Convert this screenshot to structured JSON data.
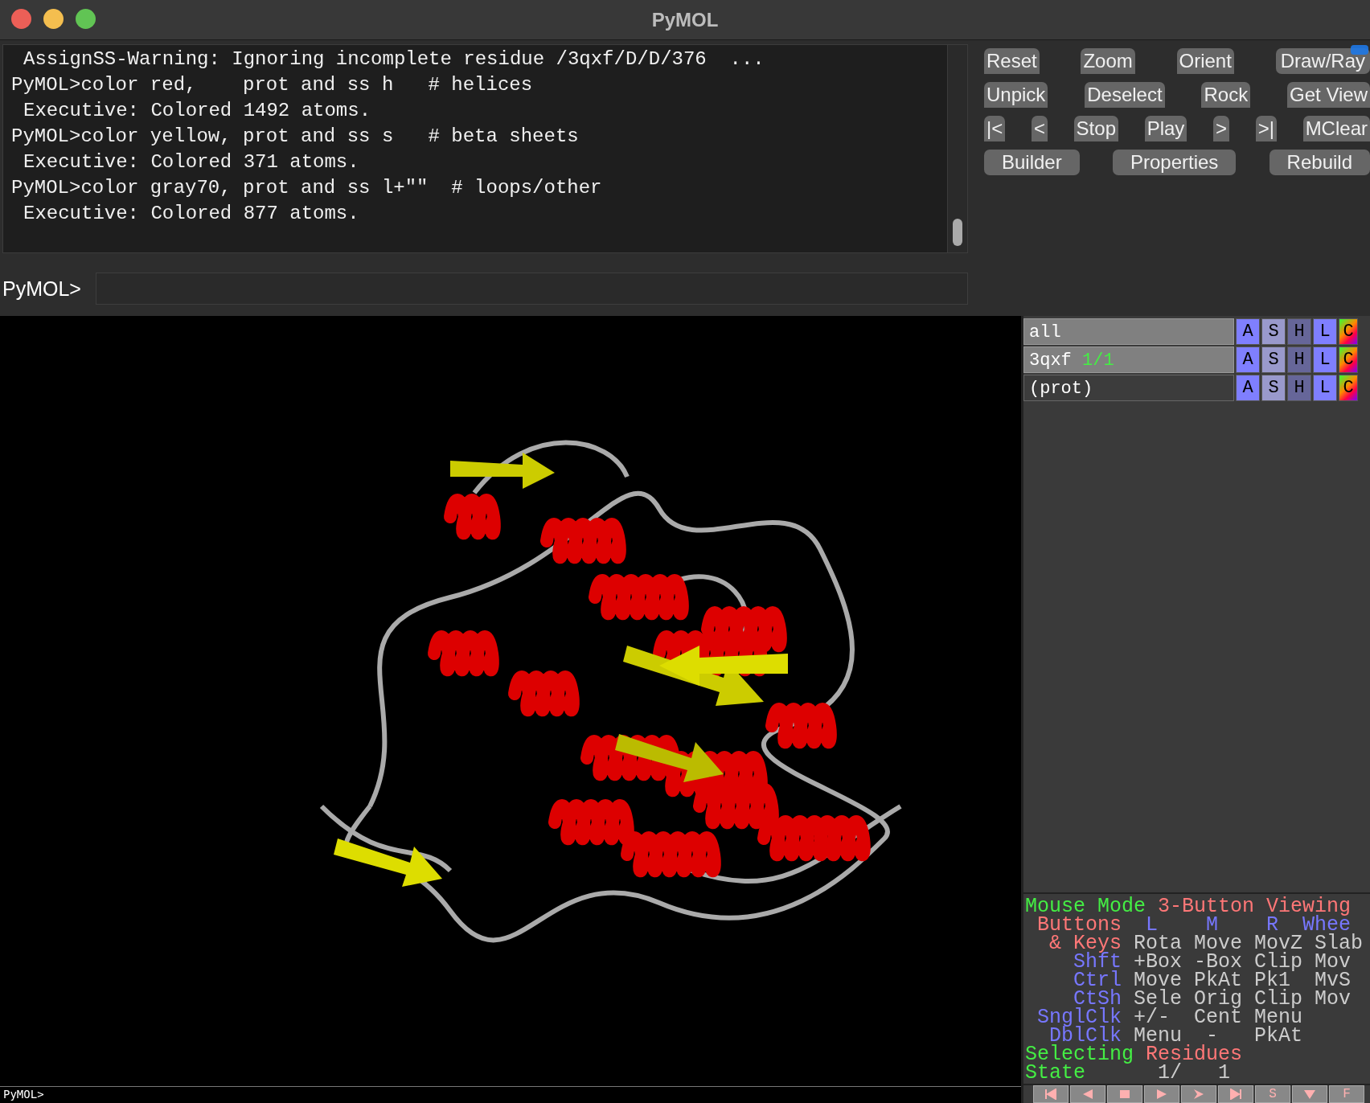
{
  "window": {
    "title": "PyMOL"
  },
  "console": {
    "lines": [
      {
        "kind": "output",
        "text": "AssignSS-Warning: Ignoring incomplete residue /3qxf/D/D/376  ..."
      },
      {
        "kind": "command",
        "text": "PyMOL>color red,    prot and ss h   # helices"
      },
      {
        "kind": "output",
        "text": "Executive: Colored 1492 atoms."
      },
      {
        "kind": "command",
        "text": "PyMOL>color yellow, prot and ss s   # beta sheets"
      },
      {
        "kind": "output",
        "text": "Executive: Colored 371 atoms."
      },
      {
        "kind": "command",
        "text": "PyMOL>color gray70, prot and ss l+\"\"  # loops/other"
      },
      {
        "kind": "output",
        "text": "Executive: Colored 877 atoms."
      }
    ]
  },
  "command_line": {
    "prompt": "PyMOL>"
  },
  "button_rows": [
    [
      {
        "label": "Reset",
        "focused": false
      },
      {
        "label": "Zoom",
        "focused": false
      },
      {
        "label": "Orient",
        "focused": false
      },
      {
        "label": "Draw/Ray",
        "focused": true
      }
    ],
    [
      {
        "label": "Unpick",
        "focused": false
      },
      {
        "label": "Deselect",
        "focused": false
      },
      {
        "label": "Rock",
        "focused": false
      },
      {
        "label": "Get View",
        "focused": false
      }
    ],
    [
      {
        "label": "|<",
        "focused": false
      },
      {
        "label": "<",
        "focused": false
      },
      {
        "label": "Stop",
        "focused": false
      },
      {
        "label": "Play",
        "focused": false
      },
      {
        "label": ">",
        "focused": false
      },
      {
        "label": ">|",
        "focused": false
      },
      {
        "label": "MClear",
        "focused": false
      }
    ],
    [
      {
        "label": "Builder",
        "focused": false
      },
      {
        "label": "Properties",
        "focused": false
      },
      {
        "label": "Rebuild",
        "focused": false
      }
    ]
  ],
  "objects": [
    {
      "name": "all",
      "enabled": true,
      "actions": [
        "A",
        "S",
        "H",
        "L",
        "C"
      ]
    },
    {
      "name": "3qxf",
      "state": "1/1",
      "enabled": true,
      "actions": [
        "A",
        "S",
        "H",
        "L",
        "C"
      ]
    },
    {
      "name": "(prot)",
      "enabled": false,
      "actions": [
        "A",
        "S",
        "H",
        "L",
        "C"
      ]
    }
  ],
  "mouse_panel": [
    [
      {
        "text": "Mouse Mode ",
        "color": "#44ee44"
      },
      {
        "text": "3-Button Viewing",
        "color": "#ff7777"
      }
    ],
    [
      {
        "text": " Buttons",
        "color": "#ff7777"
      },
      {
        "text": "  L    M    R  Whee",
        "color": "#7777ff"
      }
    ],
    [
      {
        "text": "  & Keys",
        "color": "#ff7777"
      },
      {
        "text": " Rota Move MovZ Slab",
        "color": "#cccccc"
      }
    ],
    [
      {
        "text": "    Shft",
        "color": "#7777ff"
      },
      {
        "text": " +Box -Box Clip Mov",
        "color": "#cccccc"
      }
    ],
    [
      {
        "text": "    Ctrl",
        "color": "#7777ff"
      },
      {
        "text": " Move PkAt Pk1  MvS",
        "color": "#cccccc"
      }
    ],
    [
      {
        "text": "    CtSh",
        "color": "#7777ff"
      },
      {
        "text": " Sele Orig Clip Mov",
        "color": "#cccccc"
      }
    ],
    [
      {
        "text": " SnglClk",
        "color": "#7777ff"
      },
      {
        "text": " +/-  Cent Menu",
        "color": "#cccccc"
      }
    ],
    [
      {
        "text": "  DblClk",
        "color": "#7777ff"
      },
      {
        "text": " Menu  -   PkAt",
        "color": "#cccccc"
      }
    ],
    [
      {
        "text": "Selecting ",
        "color": "#44ee44"
      },
      {
        "text": "Residues",
        "color": "#ff7777"
      }
    ],
    [
      {
        "text": "State",
        "color": "#44ee44"
      },
      {
        "text": "      1/   1",
        "color": "#cccccc"
      }
    ]
  ],
  "playback_buttons": [
    {
      "kind": "first"
    },
    {
      "kind": "prev"
    },
    {
      "kind": "stop"
    },
    {
      "kind": "play"
    },
    {
      "kind": "next"
    },
    {
      "kind": "last"
    },
    {
      "kind": "text",
      "label": "S"
    },
    {
      "kind": "down"
    },
    {
      "kind": "text",
      "label": "F"
    }
  ],
  "viewer_prompt": "PyMOL>"
}
